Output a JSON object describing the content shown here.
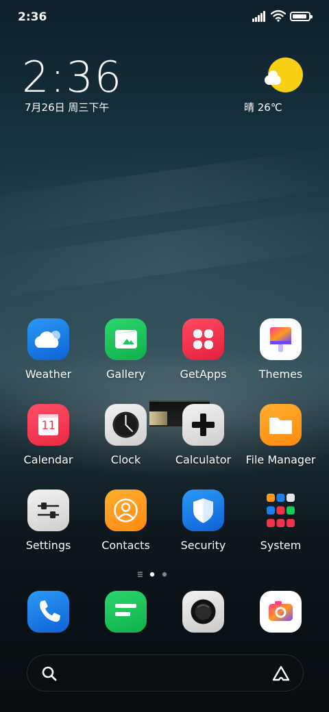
{
  "status_bar": {
    "time": "2:36",
    "signal_bars": 5,
    "battery_level": 0.9
  },
  "clock_widget": {
    "time": "2:36",
    "date": "7月26日 周三下午"
  },
  "weather_widget": {
    "condition_icon": "sun-with-cloud-icon",
    "text": "晴 26℃"
  },
  "apps": [
    {
      "label": "Weather",
      "icon": "weather-icon",
      "color": "#1a7fe8"
    },
    {
      "label": "Gallery",
      "icon": "gallery-icon",
      "color": "#1bc85c"
    },
    {
      "label": "GetApps",
      "icon": "getapps-icon",
      "color": "#f0324b"
    },
    {
      "label": "Themes",
      "icon": "themes-icon",
      "color": "#ffffff"
    },
    {
      "label": "Calendar",
      "icon": "calendar-icon",
      "color": "#f5344e",
      "date_number": "11"
    },
    {
      "label": "Clock",
      "icon": "clock-icon",
      "color": "#e6e6e6"
    },
    {
      "label": "Calculator",
      "icon": "calculator-icon",
      "color": "#e6e6e6"
    },
    {
      "label": "File Manager",
      "icon": "folder-icon",
      "color": "#ff9a1f"
    },
    {
      "label": "Settings",
      "icon": "settings-icon",
      "color": "#e6e6e6"
    },
    {
      "label": "Contacts",
      "icon": "contacts-icon",
      "color": "#ff9a1f"
    },
    {
      "label": "Security",
      "icon": "security-icon",
      "color": "#1a7fe8"
    },
    {
      "label": "System",
      "icon": "system-folder-icon",
      "color": "#ffffff"
    }
  ],
  "page_indicator": {
    "pages": 2,
    "current": 1
  },
  "dock": [
    {
      "icon": "phone-icon",
      "color": "#1a7fe8"
    },
    {
      "icon": "messages-icon",
      "color": "#1bc85c"
    },
    {
      "icon": "camera-icon",
      "color": "#e6e6e6"
    },
    {
      "icon": "browser-icon",
      "color": "#ffffff"
    }
  ],
  "search_bar": {
    "left_icon": "search-icon",
    "right_icon": "assistant-icon"
  }
}
